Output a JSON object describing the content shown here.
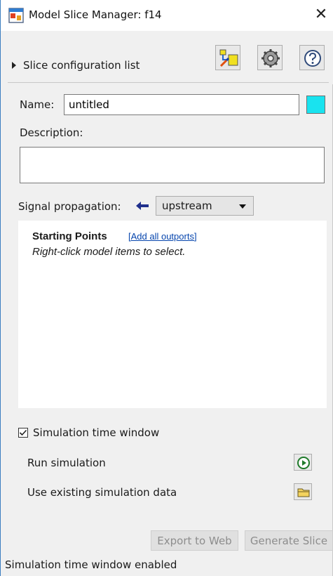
{
  "window": {
    "title": "Model Slice Manager: f14",
    "close_glyph": "✕"
  },
  "toolbar": {
    "icons": [
      "highlight-slice-icon",
      "gear-icon",
      "help-icon"
    ]
  },
  "slice_config": {
    "label": "Slice configuration list"
  },
  "name_field": {
    "label": "Name:",
    "value": "untitled",
    "color": "#19e3ef"
  },
  "description": {
    "label": "Description:",
    "value": ""
  },
  "signal_propagation": {
    "label": "Signal propagation:",
    "selected": "upstream",
    "arrow_color": "#1f2f8c"
  },
  "starting_points": {
    "heading": "Starting Points",
    "link": "[Add all outports]",
    "hint": "Right-click model items to select."
  },
  "simulation": {
    "window_label": "Simulation time window",
    "window_checked": true,
    "run_label": "Run simulation",
    "existing_label": "Use existing simulation data"
  },
  "buttons": {
    "export": "Export to Web",
    "generate": "Generate Slice"
  },
  "status": "Simulation time window enabled"
}
